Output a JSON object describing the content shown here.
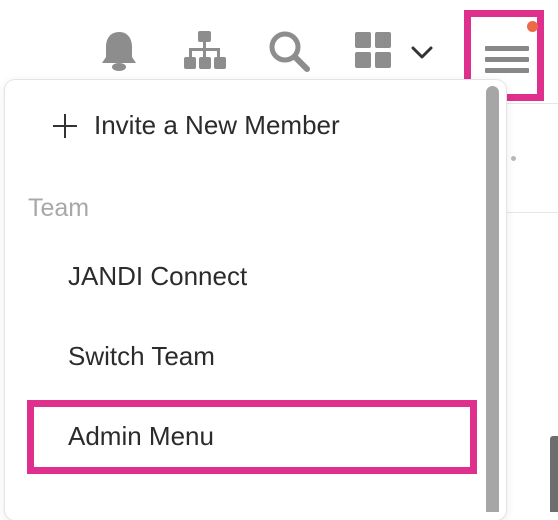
{
  "header": {
    "icons": [
      "bell-icon",
      "org-chart-icon",
      "search-icon",
      "apps-grid-icon",
      "chevron-down-icon",
      "hamburger-menu-icon"
    ],
    "notification_dot_color": "#ec6a48",
    "highlight_color": "#e0308d"
  },
  "dropdown": {
    "invite_label": "Invite a New Member",
    "team_section_label": "Team",
    "items": [
      {
        "label": "JANDI Connect"
      },
      {
        "label": "Switch Team"
      },
      {
        "label": "Admin Menu"
      }
    ]
  }
}
